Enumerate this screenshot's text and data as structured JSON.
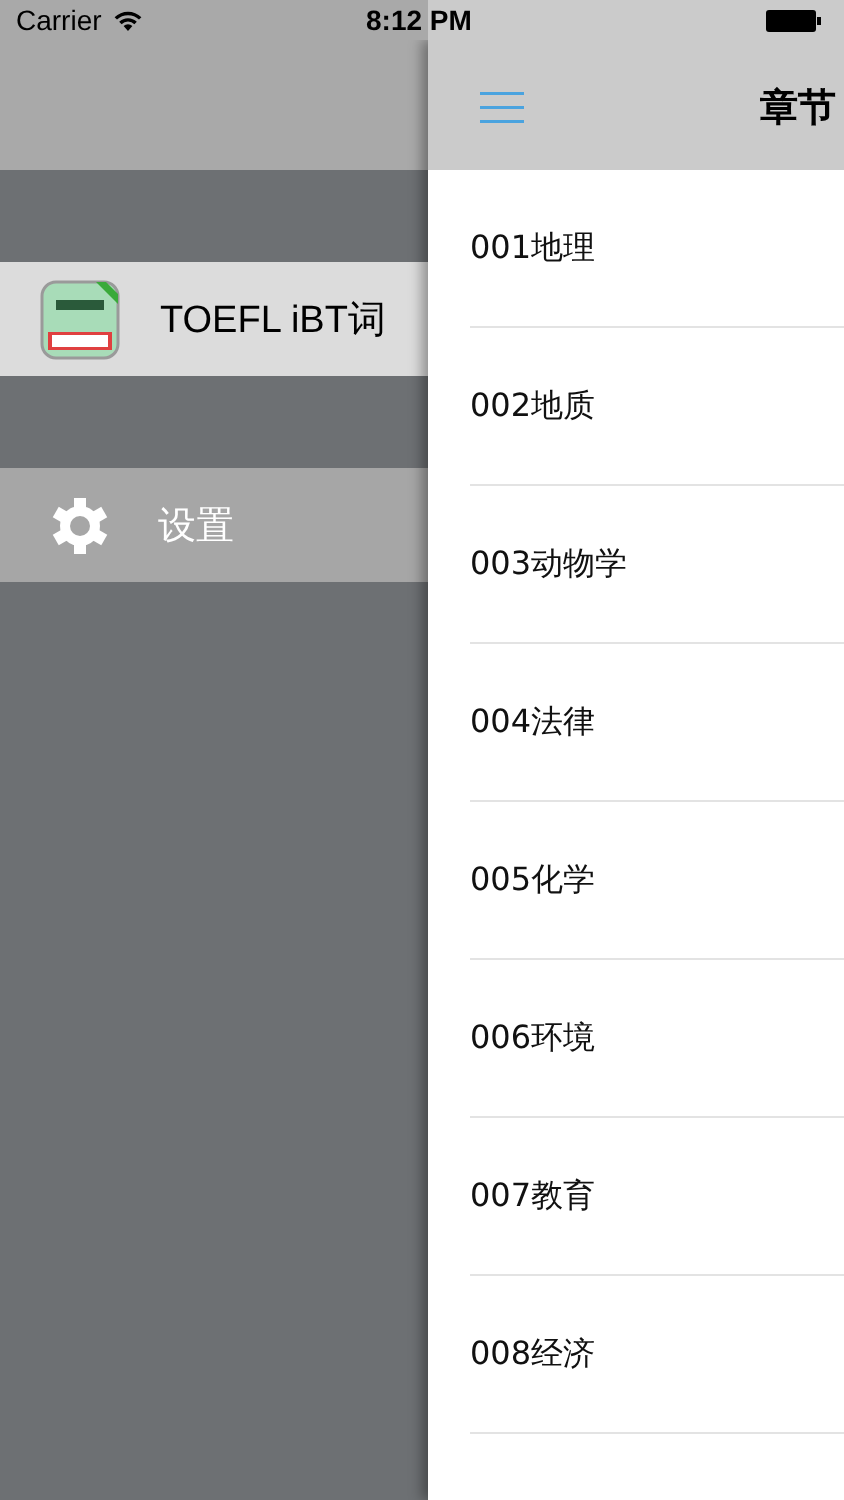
{
  "status_bar": {
    "carrier": "Carrier",
    "time": "8:12 PM"
  },
  "sidebar": {
    "items": [
      {
        "kind": "app",
        "label": "TOEFL iBT词",
        "selected": true
      },
      {
        "kind": "settings",
        "label": "设置",
        "selected": false
      }
    ]
  },
  "nav_bar": {
    "title": "章节"
  },
  "chapters": [
    "001地理",
    "002地质",
    "003动物学",
    "004法律",
    "005化学",
    "006环境",
    "007教育",
    "008经济"
  ]
}
